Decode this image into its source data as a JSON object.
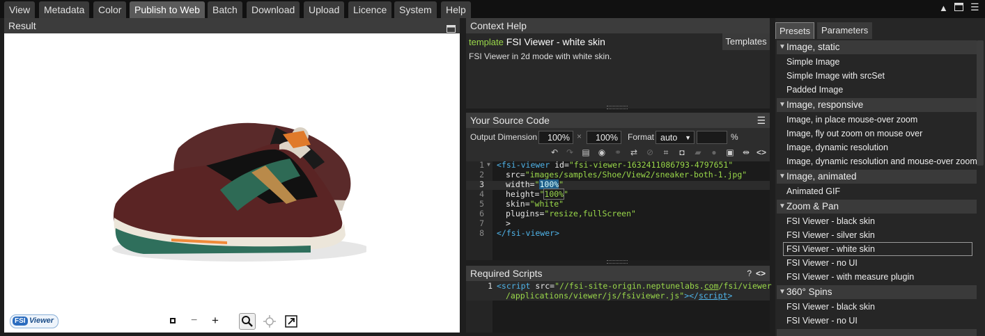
{
  "menu": {
    "tabs": [
      {
        "label": "View",
        "active": false
      },
      {
        "label": "Metadata",
        "active": false
      },
      {
        "label": "Color",
        "active": false
      },
      {
        "label": "Publish to Web",
        "active": true
      },
      {
        "label": "Batch",
        "active": false
      },
      {
        "label": "Download",
        "active": false
      },
      {
        "label": "Upload",
        "active": false
      },
      {
        "label": "Licence",
        "active": false
      },
      {
        "label": "System",
        "active": false
      },
      {
        "label": "Help",
        "active": false
      }
    ]
  },
  "result": {
    "title": "Result",
    "badge_fsi": "FSI",
    "badge_viewer": "Viewer",
    "controls": [
      "stop-icon",
      "minus-icon",
      "plus-icon",
      "zoom-icon",
      "pan-icon",
      "fullscreen-icon"
    ]
  },
  "context_help": {
    "title": "Context Help",
    "template_prefix": "template",
    "template_name": "FSI Viewer - white skin",
    "templates_button": "Templates",
    "description": "FSI Viewer in 2d mode with white skin."
  },
  "source": {
    "title": "Your Source Code",
    "output_label": "Output Dimension",
    "width_value": "100%",
    "times": "×",
    "height_value": "100%",
    "format_label": "Format",
    "format_value": "auto",
    "format_extra": "",
    "percent": "%",
    "line_numbers": [
      "1",
      "2",
      "3",
      "4",
      "5",
      "6",
      "7",
      "8"
    ],
    "code": {
      "l1_tag": "<fsi-viewer",
      "l1_attr": " id=",
      "l1_val": "\"fsi-viewer-1632411086793-4797651\"",
      "l2_attr": "src=",
      "l2_val": "\"images/samples/Shoe/View2/sneaker-both-1.jpg\"",
      "l3_attr": "width=",
      "l3_q1": "\"",
      "l3_hl": "100%",
      "l3_q2": "\"",
      "l4_attr": "height=",
      "l4_q1": "\"",
      "l4_hl": "100%",
      "l4_q2": "\"",
      "l5_attr": "skin=",
      "l5_val": "\"white\"",
      "l6_attr": "plugins=",
      "l6_val": "\"resize,fullScreen\"",
      "l7": ">",
      "l8": "</fsi-viewer>"
    }
  },
  "scripts": {
    "title": "Required Scripts",
    "help": "?",
    "code_icon": "<>",
    "line_number": "1",
    "line1_a": "<script",
    "line1_b": " src=",
    "line1_c": "\"//fsi-site-origin.neptunelabs.",
    "line1_d": "com",
    "line1_e": "/fsi/viewer",
    "line2_a": "/applications/viewer/js/fsiviewer.js\"",
    "line2_b": "></",
    "line2_c": "script",
    "line2_d": ">"
  },
  "presets": {
    "tab_presets": "Presets",
    "tab_parameters": "Parameters",
    "sections": [
      {
        "title": "Image, static",
        "items": [
          "Simple Image",
          "Simple Image with srcSet",
          "Padded Image"
        ]
      },
      {
        "title": "Image, responsive",
        "items": [
          "Image, in place mouse-over zoom",
          "Image, fly out zoom on mouse over",
          "Image, dynamic resolution",
          "Image, dynamic resolution and mouse-over zoom"
        ]
      },
      {
        "title": "Image, animated",
        "items": [
          "Animated GIF"
        ]
      },
      {
        "title": "Zoom & Pan",
        "items": [
          "FSI Viewer - black skin",
          "FSI Viewer - silver skin",
          "FSI Viewer - white skin",
          "FSI Viewer - no UI",
          "FSI Viewer - with measure plugin"
        ]
      },
      {
        "title": "360° Spins",
        "items": [
          "FSI Viewer - black skin",
          "FSI Viewer - no UI"
        ]
      }
    ],
    "selected": "FSI Viewer - white skin"
  },
  "colors": {
    "accent_green": "#9ad84a",
    "tag_blue": "#4fb3e8",
    "highlight_bg": "#1f5f8a"
  }
}
